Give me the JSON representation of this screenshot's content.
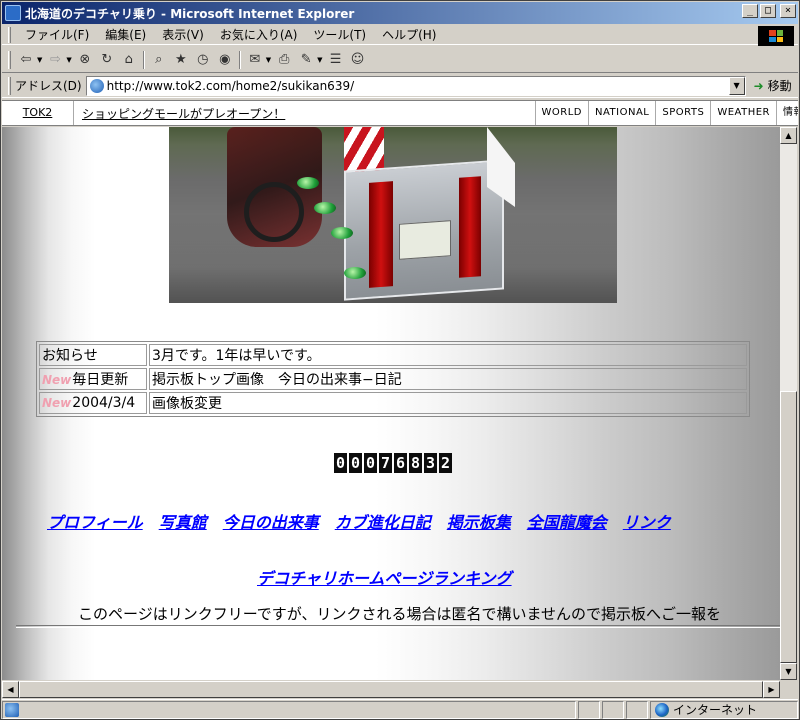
{
  "window": {
    "title": "北海道のデコチャリ乗り - Microsoft Internet Explorer",
    "buttons": {
      "minimize": "_",
      "maximize": "□",
      "close": "×"
    }
  },
  "menu": [
    "ファイル(F)",
    "編集(E)",
    "表示(V)",
    "お気に入り(A)",
    "ツール(T)",
    "ヘルプ(H)"
  ],
  "toolbar": {
    "icons": [
      "back-icon",
      "forward-icon",
      "stop-icon",
      "refresh-icon",
      "home-icon",
      "search-icon",
      "favorites-icon",
      "history-icon",
      "media-icon",
      "mail-icon",
      "print-icon",
      "edit-icon",
      "discuss-icon",
      "messenger-icon"
    ]
  },
  "address": {
    "label": "アドレス(D)",
    "url": "http://www.tok2.com/home2/sukikan639/",
    "go": "移動"
  },
  "linkbar": {
    "tok2": "TOK2",
    "promo": "ショッピングモールがプレオープン！",
    "tabs": [
      "WORLD",
      "NATIONAL",
      "SPORTS",
      "WEATHER",
      "情報"
    ]
  },
  "notice": {
    "rows": [
      {
        "badge": "",
        "label": "お知らせ",
        "text": "3月です。1年は早いです。"
      },
      {
        "badge": "New",
        "label": "毎日更新",
        "text": "掲示板トップ画像　今日の出来事−日記"
      },
      {
        "badge": "New",
        "label": "2004/3/4",
        "text": "画像板変更"
      }
    ]
  },
  "counter": "00076832",
  "links": [
    "プロフィール",
    "写真館",
    "今日の出来事",
    "カブ進化日記",
    "掲示板集",
    "全国龍魔会",
    "リンク"
  ],
  "ranking_link": "デコチャリホームページランキング",
  "free_text": "このページはリンクフリーですが、リンクされる場合は匿名で構いませんので掲示板へご一報を",
  "status": {
    "zone": "インターネット"
  },
  "colors": {
    "link": "#0000ff",
    "titlebar": "#0a246a",
    "new_badge": "#f0a0b0"
  }
}
